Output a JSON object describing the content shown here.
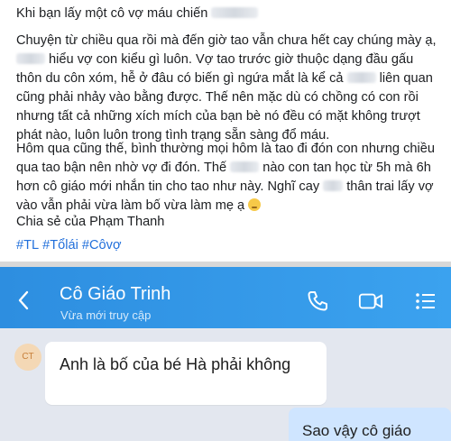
{
  "post": {
    "title": "Khi bạn lấy một cô vợ máu chiến",
    "p1": {
      "t1": "Chuyện từ chiều qua rồi mà đến giờ tao vẫn chưa hết cay chúng mày ạ, ",
      "t2": " hiểu vợ con kiểu gì luôn.  Vợ tao trước giờ thuộc dạng đầu gấu thôn du côn xóm, hễ ở đâu có biến gì ngứa mắt là kể cả ",
      "t3": " liên quan cũng phải nhảy vào bằng được. Thế nên mặc dù có chồng có con rồi nhưng tất cả những xích mích của bạn bè nó đều có mặt không trượt phát nào, luôn luôn trong tình trạng sẵn sàng đổ máu."
    },
    "p2": {
      "t1": "Hôm qua cũng thế, bình thường mọi hôm là tao đi đón con nhưng chiều qua tao bận nên nhờ vợ đi đón. Thế ",
      "t2": " nào con tan học từ 5h mà 6h hơn cô giáo mới nhắn tin cho tao như này. Nghĩ cay ",
      "t3": " thân trai lấy vợ vào vẫn phải vừa làm bố vừa làm mẹ ạ "
    },
    "share": "Chia sẻ của Phạm Thanh",
    "tags": [
      "#TL",
      "#Tổlái",
      "#Côvợ"
    ]
  },
  "chat": {
    "contact_name": "Cô Giáo Trinh",
    "status": "Vừa mới truy cập",
    "avatar_initials": "CT",
    "incoming": "Anh là bố của bé Hà phải không",
    "outgoing": "Sao vậy cô giáo"
  },
  "colors": {
    "header_start": "#2d8ee0",
    "header_end": "#3ba2ef",
    "hashtag": "#216fdb",
    "chat_bg": "#e3e7ef",
    "outgoing_bubble": "#cfe5ff"
  },
  "icons": [
    "back-arrow-icon",
    "phone-icon",
    "video-camera-icon",
    "menu-list-icon",
    "pensive-face-emoji"
  ]
}
